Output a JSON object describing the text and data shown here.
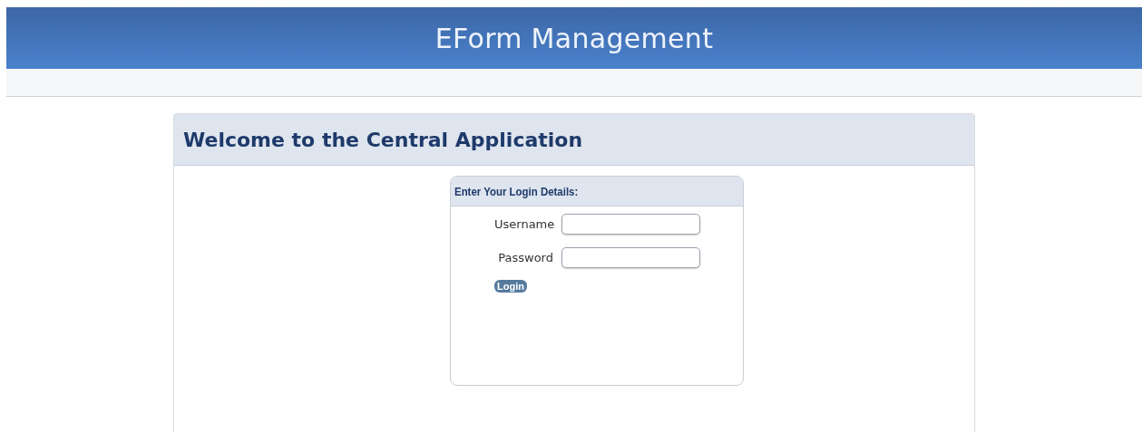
{
  "header": {
    "title": "EForm Management"
  },
  "panel": {
    "title": "Welcome to the Central Application"
  },
  "login_box": {
    "title": "Enter Your Login Details:",
    "fields": [
      {
        "label": "Username"
      },
      {
        "label": "Password"
      }
    ],
    "button": "Login"
  }
}
